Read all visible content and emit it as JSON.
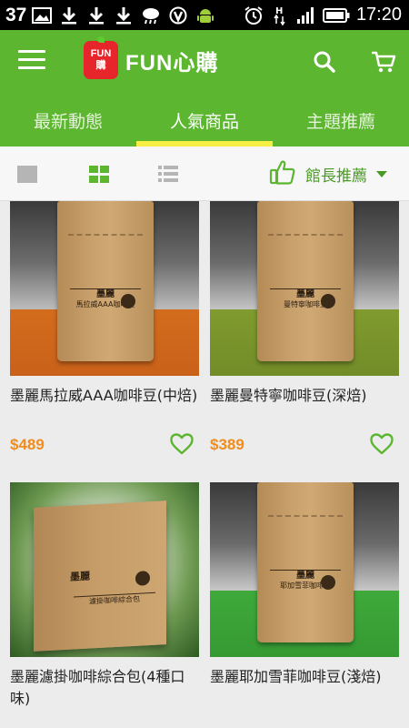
{
  "status_bar": {
    "left_number": "37",
    "time": "17:20"
  },
  "header": {
    "logo_badge_line1": "FUN",
    "logo_badge_line2": "購",
    "logo_text": "FUN心購"
  },
  "tabs": [
    {
      "label": "最新動態"
    },
    {
      "label": "人氣商品"
    },
    {
      "label": "主題推薦"
    }
  ],
  "active_tab": "人氣商品",
  "filter": {
    "sort_label": "館長推薦"
  },
  "products": [
    {
      "title": "墨麗馬拉威AAA咖啡豆(中焙)",
      "price": "$489",
      "bag_text": "馬拉威AAA咖啡豆",
      "bg_color": "#d26a1c"
    },
    {
      "title": "墨麗曼特寧咖啡豆(深焙)",
      "price": "$389",
      "bag_text": "曼特寧咖啡豆",
      "bg_color": "#7f9a2c"
    },
    {
      "title": "墨麗濾掛咖啡綜合包(4種口味)",
      "price": "",
      "bag_text": "濾掛咖啡綜合包",
      "bg_color": "#5c9c3c"
    },
    {
      "title": "墨麗耶加雪菲咖啡豆(淺焙)",
      "price": "",
      "bag_text": "耶加雪菲咖啡豆",
      "bg_color": "#3ea83a"
    }
  ],
  "colors": {
    "brand_green": "#5cb630",
    "indicator_yellow": "#f6ee45",
    "price_orange": "#f18d1d",
    "heart_green": "#5cb630"
  }
}
